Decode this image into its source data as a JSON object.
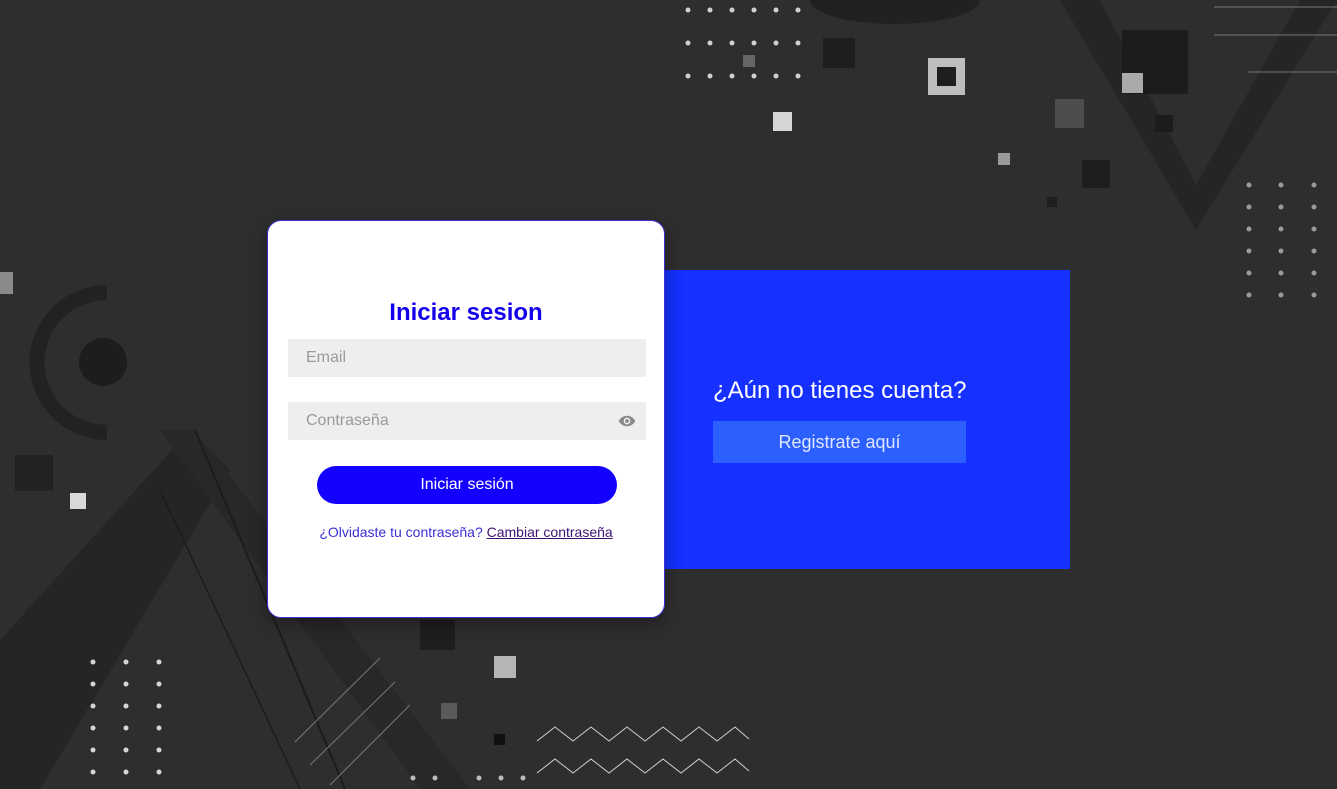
{
  "login": {
    "title": "Iniciar sesion",
    "email_placeholder": "Email",
    "password_placeholder": "Contraseña",
    "password_toggle_icon": "eye-icon",
    "submit_label": "Iniciar sesión",
    "forgot_text": "¿Olvidaste tu contraseña?",
    "change_password_link": "Cambiar contraseña"
  },
  "register": {
    "title": "¿Aún no tienes cuenta?",
    "button_label": "Registrate aquí"
  },
  "colors": {
    "background": "#2f2e2e",
    "accent_primary": "#1400ff",
    "register_panel": "#1530ff",
    "register_button": "#2b60ff"
  }
}
